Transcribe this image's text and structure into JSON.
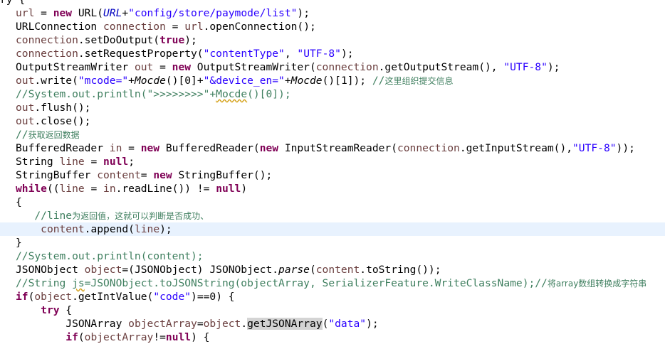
{
  "editor": {
    "lines": [
      [
        {
          "t": "ry {",
          "c": ""
        }
      ],
      [
        {
          "t": "url",
          "c": "var"
        },
        {
          "t": " = ",
          "c": ""
        },
        {
          "t": "new",
          "c": "kw"
        },
        {
          "t": " URL(",
          "c": ""
        },
        {
          "t": "URL",
          "c": "fld it"
        },
        {
          "t": "+",
          "c": ""
        },
        {
          "t": "\"config/store/paymode/list\"",
          "c": "str"
        },
        {
          "t": ");",
          "c": ""
        }
      ],
      [
        {
          "t": "URLConnection ",
          "c": ""
        },
        {
          "t": "connection",
          "c": "var"
        },
        {
          "t": " = ",
          "c": ""
        },
        {
          "t": "url",
          "c": "var"
        },
        {
          "t": ".openConnection();",
          "c": ""
        }
      ],
      [
        {
          "t": "connection",
          "c": "var"
        },
        {
          "t": ".setDoOutput(",
          "c": ""
        },
        {
          "t": "true",
          "c": "kw"
        },
        {
          "t": ");",
          "c": ""
        }
      ],
      [
        {
          "t": "connection",
          "c": "var"
        },
        {
          "t": ".setRequestProperty(",
          "c": ""
        },
        {
          "t": "\"contentType\"",
          "c": "str"
        },
        {
          "t": ", ",
          "c": ""
        },
        {
          "t": "\"UTF-8\"",
          "c": "str"
        },
        {
          "t": ");",
          "c": ""
        }
      ],
      [
        {
          "t": "OutputStreamWriter ",
          "c": ""
        },
        {
          "t": "out",
          "c": "var"
        },
        {
          "t": " = ",
          "c": ""
        },
        {
          "t": "new",
          "c": "kw"
        },
        {
          "t": " OutputStreamWriter(",
          "c": ""
        },
        {
          "t": "connection",
          "c": "var"
        },
        {
          "t": ".getOutputStream(), ",
          "c": ""
        },
        {
          "t": "\"UTF-8\"",
          "c": "str"
        },
        {
          "t": ");",
          "c": ""
        }
      ],
      [
        {
          "t": "out",
          "c": "var"
        },
        {
          "t": ".write(",
          "c": ""
        },
        {
          "t": "\"mcode=\"",
          "c": "str"
        },
        {
          "t": "+",
          "c": ""
        },
        {
          "t": "Mocde",
          "c": "it"
        },
        {
          "t": "()[0]+",
          "c": ""
        },
        {
          "t": "\"&device_en=\"",
          "c": "str"
        },
        {
          "t": "+",
          "c": ""
        },
        {
          "t": "Mocde",
          "c": "it"
        },
        {
          "t": "()[1]); ",
          "c": ""
        },
        {
          "t": "//",
          "c": "cmt"
        },
        {
          "t": "这里组织提交信息",
          "c": "cmt cjk"
        }
      ],
      [
        {
          "t": "//System.out.println(\">>>>>>>>\"+",
          "c": "cmt"
        },
        {
          "t": "Mocde",
          "c": "cmt sq"
        },
        {
          "t": "()[0]);",
          "c": "cmt"
        }
      ],
      [
        {
          "t": "out",
          "c": "var"
        },
        {
          "t": ".flush();",
          "c": ""
        }
      ],
      [
        {
          "t": "out",
          "c": "var"
        },
        {
          "t": ".close();",
          "c": ""
        }
      ],
      [
        {
          "t": "//",
          "c": "cmt"
        },
        {
          "t": "获取返回数据",
          "c": "cmt cjk"
        }
      ],
      [
        {
          "t": "BufferedReader ",
          "c": ""
        },
        {
          "t": "in",
          "c": "var"
        },
        {
          "t": " = ",
          "c": ""
        },
        {
          "t": "new",
          "c": "kw"
        },
        {
          "t": " BufferedReader(",
          "c": ""
        },
        {
          "t": "new",
          "c": "kw"
        },
        {
          "t": " InputStreamReader(",
          "c": ""
        },
        {
          "t": "connection",
          "c": "var"
        },
        {
          "t": ".getInputStream(),",
          "c": ""
        },
        {
          "t": "\"UTF-8\"",
          "c": "str"
        },
        {
          "t": "));",
          "c": ""
        }
      ],
      [
        {
          "t": "String ",
          "c": ""
        },
        {
          "t": "line",
          "c": "var"
        },
        {
          "t": " = ",
          "c": ""
        },
        {
          "t": "null",
          "c": "kw"
        },
        {
          "t": ";",
          "c": ""
        }
      ],
      [
        {
          "t": "StringBuffer ",
          "c": ""
        },
        {
          "t": "content",
          "c": "var"
        },
        {
          "t": "= ",
          "c": ""
        },
        {
          "t": "new",
          "c": "kw"
        },
        {
          "t": " StringBuffer();",
          "c": ""
        }
      ],
      [
        {
          "t": "while",
          "c": "kw"
        },
        {
          "t": "((",
          "c": ""
        },
        {
          "t": "line",
          "c": "var"
        },
        {
          "t": " = ",
          "c": ""
        },
        {
          "t": "in",
          "c": "var"
        },
        {
          "t": ".readLine()) != ",
          "c": ""
        },
        {
          "t": "null",
          "c": "kw"
        },
        {
          "t": ")",
          "c": ""
        }
      ],
      [
        {
          "t": "{",
          "c": ""
        }
      ],
      [
        {
          "t": "   //line",
          "c": "cmt"
        },
        {
          "t": "为返回值，这就可以判断是否成功、",
          "c": "cmt cjk"
        }
      ],
      [
        {
          "t": "    ",
          "c": ""
        },
        {
          "t": "content",
          "c": "var"
        },
        {
          "t": ".append(",
          "c": ""
        },
        {
          "t": "line",
          "c": "var"
        },
        {
          "t": ");",
          "c": ""
        }
      ],
      [
        {
          "t": "}",
          "c": ""
        }
      ],
      [
        {
          "t": "//System.out.println(content);",
          "c": "cmt"
        }
      ],
      [
        {
          "t": "JSONObject ",
          "c": ""
        },
        {
          "t": "object",
          "c": "var"
        },
        {
          "t": "=(JSONObject) JSONObject.",
          "c": ""
        },
        {
          "t": "parse",
          "c": "it"
        },
        {
          "t": "(",
          "c": ""
        },
        {
          "t": "content",
          "c": "var"
        },
        {
          "t": ".toString());",
          "c": ""
        }
      ],
      [
        {
          "t": "//String ",
          "c": "cmt"
        },
        {
          "t": "js",
          "c": "cmt sq"
        },
        {
          "t": "=JSONObject.toJSONString(objectArray, SerializerFeature.WriteClassName);//",
          "c": "cmt"
        },
        {
          "t": "将array数组转换成字符串",
          "c": "cmt cjk"
        }
      ],
      [
        {
          "t": "if",
          "c": "kw"
        },
        {
          "t": "(",
          "c": ""
        },
        {
          "t": "object",
          "c": "var"
        },
        {
          "t": ".getIntValue(",
          "c": ""
        },
        {
          "t": "\"code\"",
          "c": "str"
        },
        {
          "t": ")==0) {",
          "c": ""
        }
      ],
      [
        {
          "t": "    ",
          "c": ""
        },
        {
          "t": "try",
          "c": "kw"
        },
        {
          "t": " {",
          "c": ""
        }
      ],
      [
        {
          "t": "        JSONArray ",
          "c": ""
        },
        {
          "t": "objectArray",
          "c": "var"
        },
        {
          "t": "=",
          "c": ""
        },
        {
          "t": "object",
          "c": "var"
        },
        {
          "t": ".",
          "c": ""
        },
        {
          "t": "getJSONArray",
          "c": "occ"
        },
        {
          "t": "(",
          "c": ""
        },
        {
          "t": "\"data\"",
          "c": "str"
        },
        {
          "t": ");",
          "c": ""
        }
      ],
      [
        {
          "t": "        ",
          "c": ""
        },
        {
          "t": "if",
          "c": "kw"
        },
        {
          "t": "(",
          "c": ""
        },
        {
          "t": "objectArray",
          "c": "var"
        },
        {
          "t": "!=",
          "c": ""
        },
        {
          "t": "null",
          "c": "kw"
        },
        {
          "t": ") {",
          "c": ""
        }
      ]
    ]
  },
  "meta": {
    "current_line_index": 17,
    "line_count": 26
  }
}
